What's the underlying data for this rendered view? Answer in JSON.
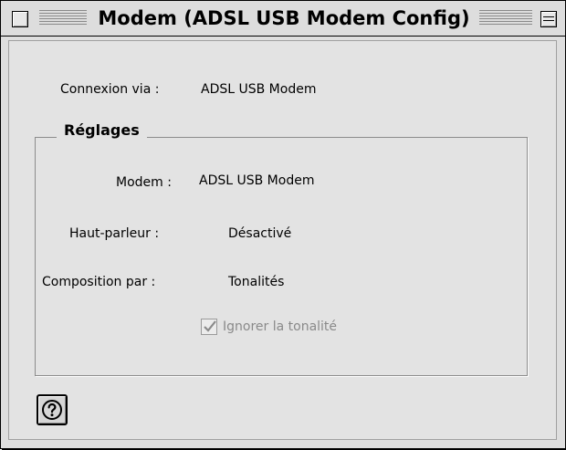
{
  "window": {
    "title": "Modem (ADSL USB Modem Config)"
  },
  "connection": {
    "label": "Connexion via :",
    "value": "ADSL USB Modem"
  },
  "settings": {
    "group_title": "Réglages",
    "modem_label": "Modem :",
    "modem_value": "ADSL USB Modem",
    "speaker_label": "Haut-parleur :",
    "speaker_value": "Désactivé",
    "dialing_label": "Composition par :",
    "dialing_value": "Tonalités",
    "ignore_tone_label": "Ignorer la tonalité",
    "ignore_tone_checked": true,
    "ignore_tone_enabled": false
  },
  "icons": {
    "close": "close-box-icon",
    "collapse": "collapse-box-icon",
    "help": "question-mark-icon",
    "check": "check-icon"
  },
  "colors": {
    "background": "#e3e3e3",
    "disabled_text": "#8a8a8a"
  }
}
